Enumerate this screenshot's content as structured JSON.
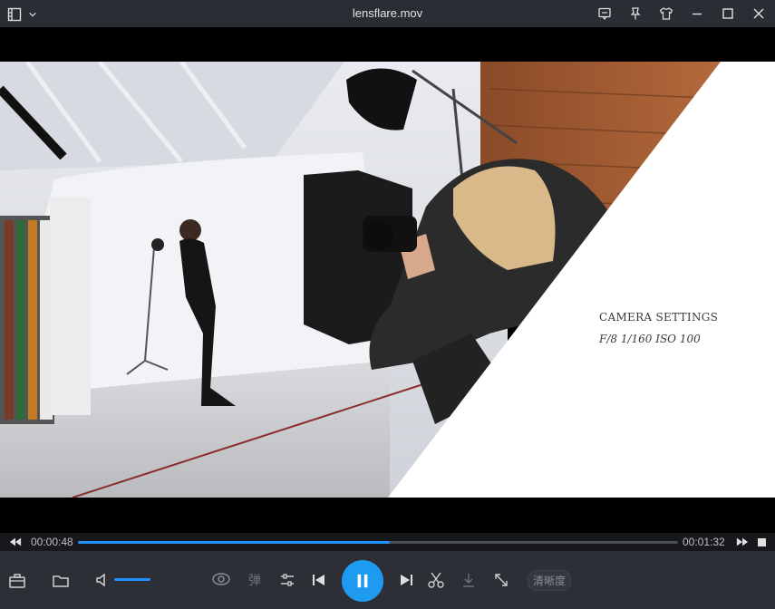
{
  "window": {
    "title": "lensflare.mov"
  },
  "overlay": {
    "heading": "CAMERA SETTINGS",
    "subheading": "F/8 1/160 ISO 100"
  },
  "progress": {
    "current_time": "00:00:48",
    "total_time": "00:01:32",
    "fraction": 0.52
  },
  "volume": {
    "level": 1.0
  },
  "controls": {
    "danmu_label": "弹",
    "clarity_label": "清晰度"
  },
  "colors": {
    "accent": "#1e9bf0",
    "titlebar_bg": "#2a2d33",
    "controlbar_bg": "#2c2f35"
  },
  "icons": {
    "menu": "playlist-icon",
    "dropdown": "chevron-down-icon",
    "feedback": "message-icon",
    "pin": "pin-icon",
    "skin": "shirt-icon",
    "minimize": "minimize-icon",
    "maximize": "maximize-icon",
    "close": "close-icon"
  }
}
